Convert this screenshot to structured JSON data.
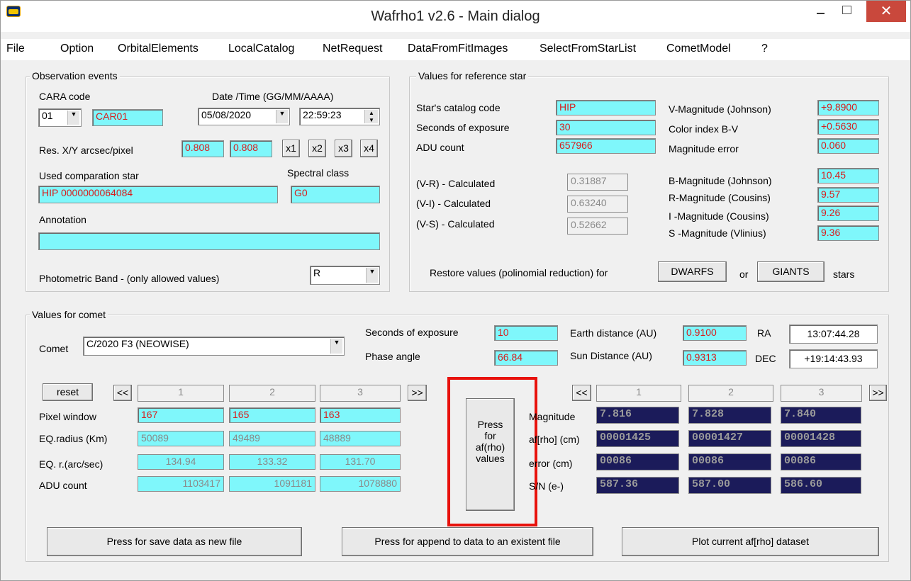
{
  "window": {
    "title": "Wafrho1 v2.6 - Main dialog",
    "app_icon": "cara-icon"
  },
  "menu": [
    "File",
    "Option",
    "OrbitalElements",
    "LocalCatalog",
    "NetRequest",
    "DataFromFitImages",
    "SelectFromStarList",
    "CometModel",
    "?"
  ],
  "observation": {
    "legend": "Observation events",
    "cara_code_label": "CARA code",
    "cara_select": "01",
    "cara_value": "CAR01",
    "datetime_label": "Date /Time  (GG/MM/AAAA)",
    "date": "05/08/2020",
    "time": "22:59:23",
    "res_label": "Res. X/Y arcsec/pixel",
    "res_x": "0.808",
    "res_y": "0.808",
    "mult_buttons": [
      "x1",
      "x2",
      "x3",
      "x4"
    ],
    "comp_star_label": "Used comparation star",
    "comp_star": "HIP 0000000064084",
    "spectral_label": "Spectral class",
    "spectral": "G0",
    "annotation_label": "Annotation",
    "annotation": "",
    "band_label": "Photometric Band  - (only allowed values)",
    "band": "R"
  },
  "refstar": {
    "legend": "Values for reference star",
    "catalog_label": "Star's catalog code",
    "catalog": "HIP",
    "exposure_label": "Seconds of exposure",
    "exposure": "30",
    "adu_label": "ADU count",
    "adu": "657966",
    "vr_label": "(V-R) - Calculated",
    "vr": "0.31887",
    "vi_label": "(V-I) -  Calculated",
    "vi": "0.63240",
    "vs_label": "(V-S) - Calculated",
    "vs": "0.52662",
    "vmag_label": "V-Magnitude (Johnson)",
    "vmag": "+9.8900",
    "bv_label": "Color index B-V",
    "bv": "+0.5630",
    "magerr_label": "Magnitude error",
    "magerr": "0.060",
    "bmag_label": "B-Magnitude (Johnson)",
    "bmag": "10.45",
    "rmag_label": "R-Magnitude (Cousins)",
    "rmag": "9.57",
    "imag_label": "I -Magnitude (Cousins)",
    "imag": "9.26",
    "smag_label": "S -Magnitude (Vlinius)",
    "smag": "9.36",
    "restore_label": "Restore values (polinomial reduction) for",
    "dwarfs": "DWARFS",
    "or": "or",
    "giants": "GIANTS",
    "stars": "stars"
  },
  "comet": {
    "legend": "Values for comet",
    "comet_label": "Comet",
    "comet": "C/2020 F3 (NEOWISE)",
    "exposure_label": "Seconds of exposure",
    "exposure": "10",
    "phase_label": "Phase angle",
    "phase": "66.84",
    "earth_label": "Earth distance (AU)",
    "earth": "0.9100",
    "sun_label": "Sun Distance (AU)",
    "sun": "0.9313",
    "ra_label": "RA",
    "ra": "13:07:44.28",
    "dec_label": "DEC",
    "dec": "+19:14:43.93",
    "reset": "reset",
    "prev": "<<",
    "next": ">>",
    "cols": [
      "1",
      "2",
      "3"
    ],
    "pixel_label": "Pixel window",
    "pixel": [
      "167",
      "165",
      "163"
    ],
    "eqr_label": "EQ.radius (Km)",
    "eqr": [
      "50089",
      "49489",
      "48889"
    ],
    "eqra_label": "EQ. r.(arc/sec)",
    "eqra": [
      "134.94",
      "133.32",
      "131.70"
    ],
    "adu_label": "ADU count",
    "adu": [
      "1103417",
      "1091181",
      "1078880"
    ],
    "press_lines": [
      "Press",
      "for",
      "af(rho)",
      "values"
    ],
    "mag_label": "Magnitude",
    "mag": [
      "7.816",
      "7.828",
      "7.840"
    ],
    "afrho_label": "af[rho] (cm)",
    "afrho": [
      "00001425",
      "00001427",
      "00001428"
    ],
    "err_label": "error (cm)",
    "err": [
      "00086",
      "00086",
      "00086"
    ],
    "sn_label": "S/N (e-)",
    "sn": [
      "587.36",
      "587.00",
      "586.60"
    ]
  },
  "bottom": {
    "save": "Press for save data as new file",
    "append": "Press for append to  data to an existent file",
    "plot": "Plot current af[rho] dataset"
  }
}
